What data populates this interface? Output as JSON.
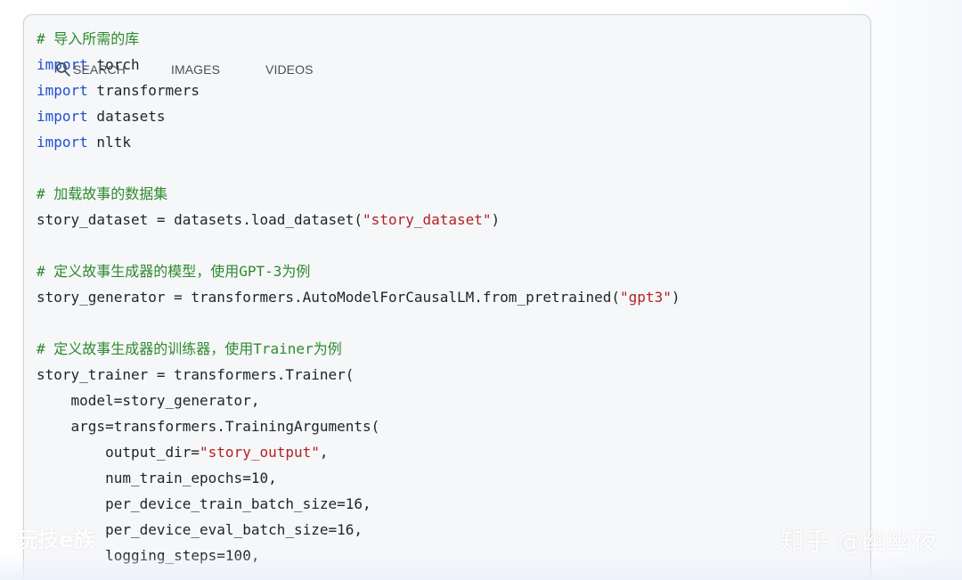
{
  "tabs": [
    {
      "label": "SEARCH",
      "icon": "search-icon"
    },
    {
      "label": "IMAGES"
    },
    {
      "label": "VIDEOS"
    }
  ],
  "code_lines": [
    [
      {
        "type": "comment",
        "text": "# 导入所需的库"
      }
    ],
    [
      {
        "type": "kw",
        "text": "import"
      },
      {
        "type": "plain",
        "text": " torch"
      }
    ],
    [
      {
        "type": "kw",
        "text": "import"
      },
      {
        "type": "plain",
        "text": " transformers"
      }
    ],
    [
      {
        "type": "kw",
        "text": "import"
      },
      {
        "type": "plain",
        "text": " datasets"
      }
    ],
    [
      {
        "type": "kw",
        "text": "import"
      },
      {
        "type": "plain",
        "text": " nltk"
      }
    ],
    [],
    [
      {
        "type": "comment",
        "text": "# 加载故事的数据集"
      }
    ],
    [
      {
        "type": "plain",
        "text": "story_dataset = datasets.load_dataset("
      },
      {
        "type": "str",
        "text": "\"story_dataset\""
      },
      {
        "type": "plain",
        "text": ")"
      }
    ],
    [],
    [
      {
        "type": "comment",
        "text": "# 定义故事生成器的模型，使用GPT-3为例"
      }
    ],
    [
      {
        "type": "plain",
        "text": "story_generator = transformers.AutoModelForCausalLM.from_pretrained("
      },
      {
        "type": "str",
        "text": "\"gpt3\""
      },
      {
        "type": "plain",
        "text": ")"
      }
    ],
    [],
    [
      {
        "type": "comment",
        "text": "# 定义故事生成器的训练器，使用Trainer为例"
      }
    ],
    [
      {
        "type": "plain",
        "text": "story_trainer = transformers.Trainer("
      }
    ],
    [
      {
        "type": "plain",
        "text": "    model=story_generator,"
      }
    ],
    [
      {
        "type": "plain",
        "text": "    args=transformers.TrainingArguments("
      }
    ],
    [
      {
        "type": "plain",
        "text": "        output_dir="
      },
      {
        "type": "str",
        "text": "\"story_output\""
      },
      {
        "type": "plain",
        "text": ","
      }
    ],
    [
      {
        "type": "plain",
        "text": "        num_train_epochs=10,"
      }
    ],
    [
      {
        "type": "plain",
        "text": "        per_device_train_batch_size=16,"
      }
    ],
    [
      {
        "type": "plain",
        "text": "        per_device_eval_batch_size=16,"
      }
    ],
    [
      {
        "type": "plain",
        "text": "        logging_steps=100,"
      }
    ]
  ],
  "watermark_left": "玩技e族",
  "watermark_right": "知乎 @幽幽夜",
  "colors": {
    "comment": "#2f8a2f",
    "keyword": "#1f4fd1",
    "string": "#b22222",
    "text": "#1f2328"
  }
}
